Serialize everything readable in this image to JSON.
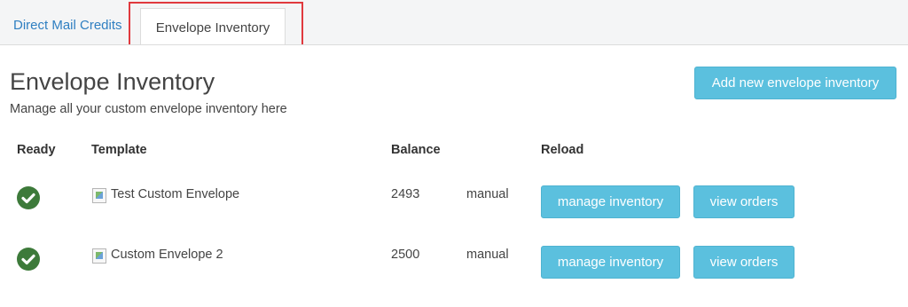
{
  "tabs": {
    "direct_mail_credits": "Direct Mail Credits",
    "envelope_inventory": "Envelope Inventory"
  },
  "page": {
    "title": "Envelope Inventory",
    "subtitle": "Manage all your custom envelope inventory here",
    "add_button": "Add new envelope inventory"
  },
  "table": {
    "headers": {
      "ready": "Ready",
      "template": "Template",
      "balance": "Balance",
      "reload": "Reload"
    },
    "rows": [
      {
        "ready": true,
        "template": "Test Custom Envelope",
        "balance": "2493",
        "reload_mode": "manual",
        "manage_button": "manage inventory",
        "orders_button": "view orders"
      },
      {
        "ready": true,
        "template": "Custom Envelope 2",
        "balance": "2500",
        "reload_mode": "manual",
        "manage_button": "manage inventory",
        "orders_button": "view orders"
      }
    ]
  },
  "colors": {
    "accent_button": "#5bc0de",
    "link": "#2f7fc1",
    "ready_icon": "#3d7a3a",
    "highlight_box": "#e0393e"
  },
  "icons": {
    "ready": "check-circle-icon",
    "template_thumbnail": "broken-image-icon"
  }
}
